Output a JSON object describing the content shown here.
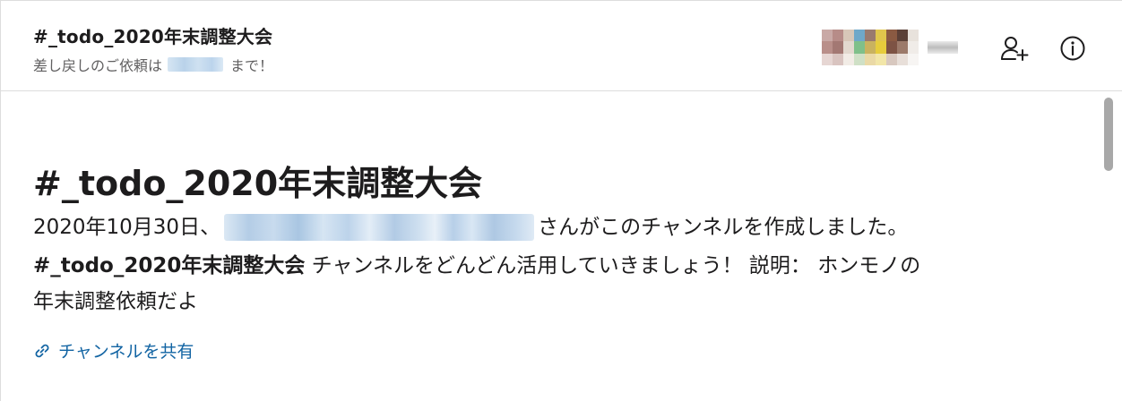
{
  "header": {
    "channel_title": "#_todo_2020年末調整大会",
    "topic_prefix": "差し戻しのご依頼は",
    "topic_suffix": "まで！"
  },
  "intro": {
    "title": "#_todo_2020年末調整大会",
    "created_prefix": "2020年10月30日、",
    "created_suffix": "さんがこのチャンネルを作成しました。",
    "channel_name": "#_todo_2020年末調整大会",
    "description_line1": " チャンネルをどんどん活用していきましょう！ 説明： ホンモノの",
    "description_line2": "年末調整依頼だよ"
  },
  "actions": {
    "share_label": "チャンネルを共有"
  },
  "icons": {
    "add_member": "person-plus-icon",
    "info": "info-icon",
    "share": "link-icon"
  },
  "colors": {
    "link": "#1264a3",
    "text": "#1d1c1d",
    "muted": "#616061"
  }
}
